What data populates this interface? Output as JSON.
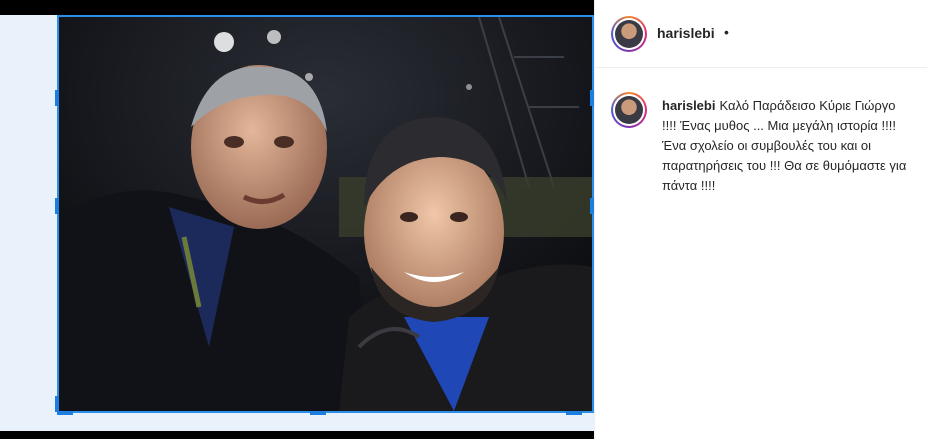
{
  "post": {
    "username": "harislebi",
    "separator": "•",
    "caption_username": "harislebi",
    "caption_text": "Καλό Παράδεισο Κύριε Γιώργο !!!! Ένας μυθος ... Μια μεγάλη ιστορία !!!! Ένα σχολείο οι συμβουλές του και οι παρατηρήσεις του !!! Θα σε θυμόμαστε για πάντα !!!!"
  },
  "colors": {
    "selection_border": "#2b8ee8",
    "left_background": "#e9f2fb",
    "text": "#262626"
  },
  "icons": {
    "avatar": "profile-photo-circle"
  }
}
